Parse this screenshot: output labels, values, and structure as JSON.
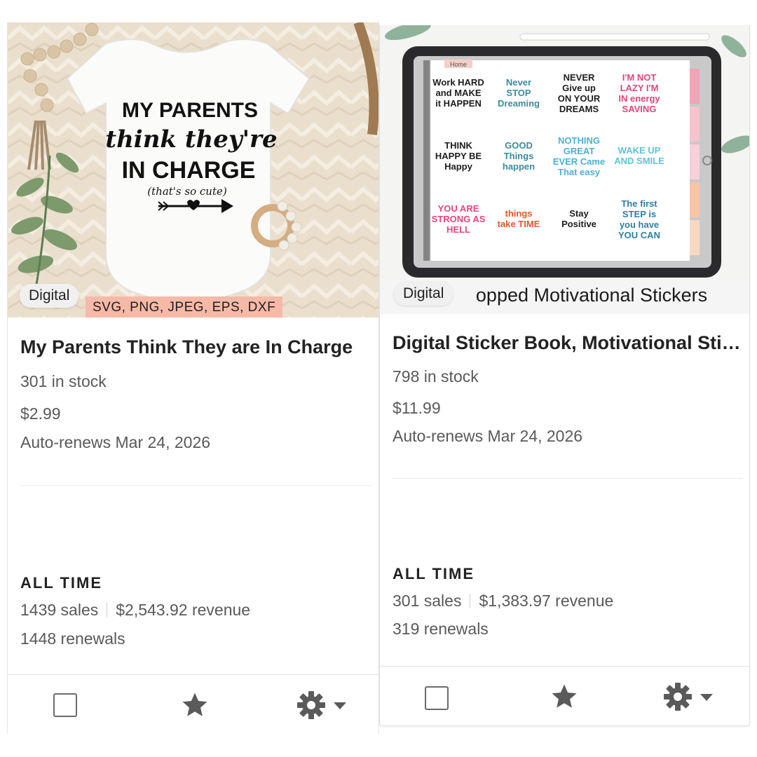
{
  "listings": [
    {
      "badge": "Digital",
      "image_caption_lines": [
        "MY PARENTS",
        "think they're",
        "IN CHARGE",
        "(that's so cute)"
      ],
      "formats_banner": "SVG, PNG, JPEG, EPS, DXF",
      "title": "My Parents Think They are In Charge",
      "stock": "301 in stock",
      "price": "$2.99",
      "renewal": "Auto-renews Mar 24, 2026",
      "section_label": "ALL TIME",
      "sales": "1439 sales",
      "revenue": "$2,543.92 revenue",
      "renewals": "1448 renewals",
      "actions": {
        "select_icon": "checkbox-icon",
        "feature_icon": "star-icon",
        "settings_icon": "gear-icon"
      }
    },
    {
      "badge": "Digital",
      "image_caption": "Hyperlinked Cropped Motivational Stickers",
      "image_caption_visible": "opped  Motivational Stickers",
      "tab_label": "Home",
      "stickers": [
        "Work HARD and MAKE it HAPPEN",
        "Never STOP Dreaming",
        "NEVER Give up ON YOUR DREAMS",
        "I'M NOT LAZY I'M IN energy SAVING MODE",
        "THINK HAPPY BE Happy",
        "GOOD Things happen",
        "NOTHING GREAT EVER Came That easy",
        "WAKE UP AND SMILE",
        "YOU ARE STRONG AS HELL",
        "things take TIME",
        "Stay Positive",
        "The first STEP is you have YOU CAN"
      ],
      "title": "Digital Sticker Book, Motivational Stickers",
      "stock": "798 in stock",
      "price": "$11.99",
      "renewal": "Auto-renews Mar 24, 2026",
      "section_label": "ALL TIME",
      "sales": "301 sales",
      "revenue": "$1,383.97 revenue",
      "renewals": "319 renewals",
      "actions": {
        "select_icon": "checkbox-icon",
        "feature_icon": "star-icon",
        "settings_icon": "gear-icon"
      }
    }
  ],
  "colors": {
    "formats_banner": "#f7b9a7",
    "icon_gray": "#5a5a5a"
  }
}
